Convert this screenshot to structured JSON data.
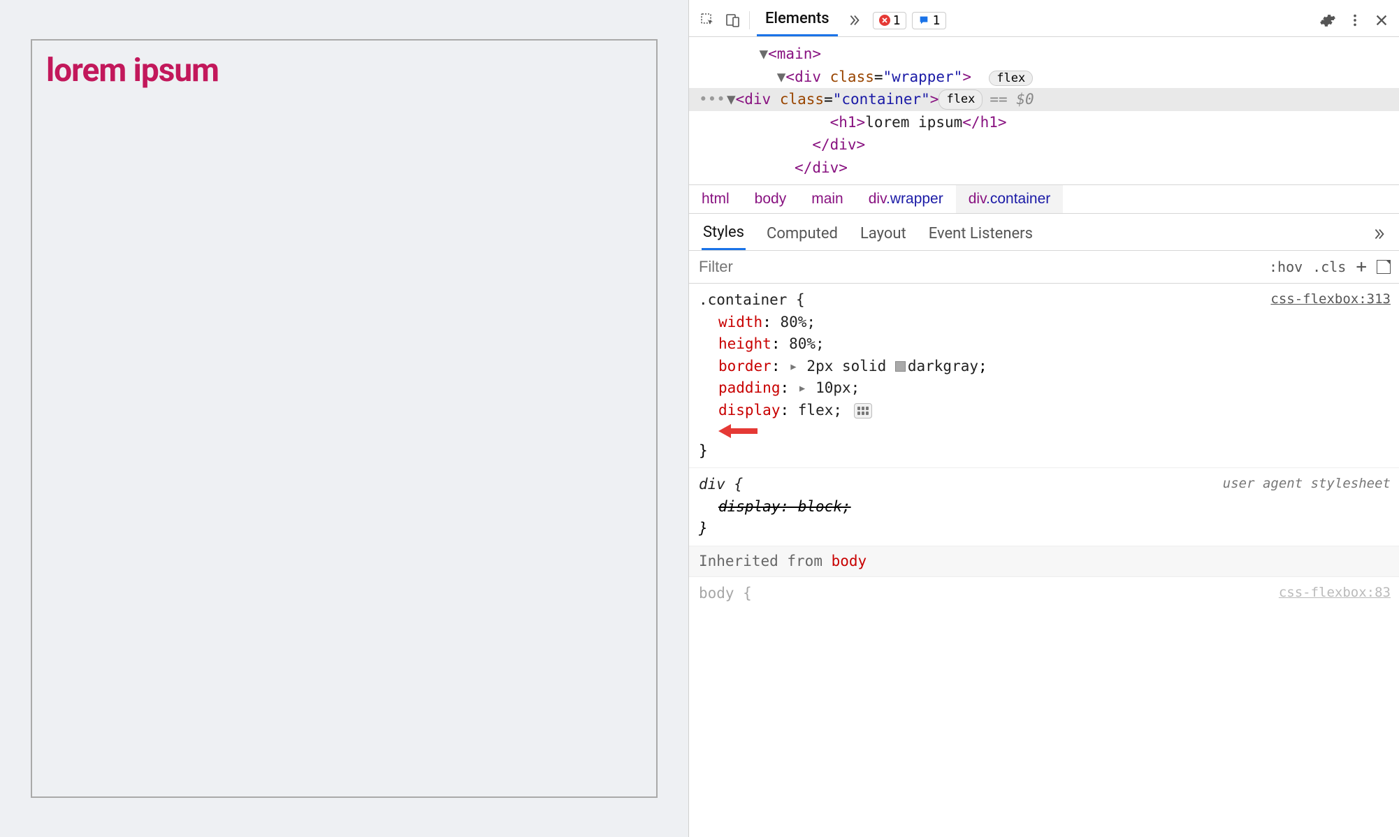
{
  "preview": {
    "heading": "lorem ipsum"
  },
  "devtools": {
    "tabs": {
      "elements": "Elements"
    },
    "error_count": "1",
    "message_count": "1",
    "dom": {
      "main_open": "<main>",
      "wrapper_open": "<div class=\"wrapper\">",
      "wrapper_badge": "flex",
      "container_open": "<div class=\"container\">",
      "container_badge": "flex",
      "selected_suffix": "== $0",
      "h1": "<h1>lorem ipsum</h1>",
      "h1_text": "lorem ipsum",
      "div_close": "</div>",
      "div_close2": "</div>"
    },
    "breadcrumbs": [
      "html",
      "body",
      "main",
      "div.wrapper",
      "div.container"
    ],
    "sidebar_tabs": [
      "Styles",
      "Computed",
      "Layout",
      "Event Listeners"
    ],
    "filter_placeholder": "Filter",
    "filter_controls": {
      "hov": ":hov",
      "cls": ".cls",
      "plus": "+"
    },
    "rules": {
      "container": {
        "selector": ".container {",
        "source": "css-flexbox:313",
        "decls": [
          {
            "prop": "width",
            "val": "80%;"
          },
          {
            "prop": "height",
            "val": "80%;"
          },
          {
            "prop": "border",
            "val": "2px solid ",
            "color_name": "darkgray",
            "trailing": ";"
          },
          {
            "prop": "padding",
            "val": "10px;"
          },
          {
            "prop": "display",
            "val": "flex;"
          }
        ],
        "close": "}"
      },
      "div_ua": {
        "selector": "div {",
        "source": "user agent stylesheet",
        "decl": "display: block;",
        "close": "}"
      },
      "inherited_label": "Inherited from ",
      "inherited_from": "body",
      "body_sel": "body {",
      "body_src": "css-flexbox:83"
    }
  }
}
